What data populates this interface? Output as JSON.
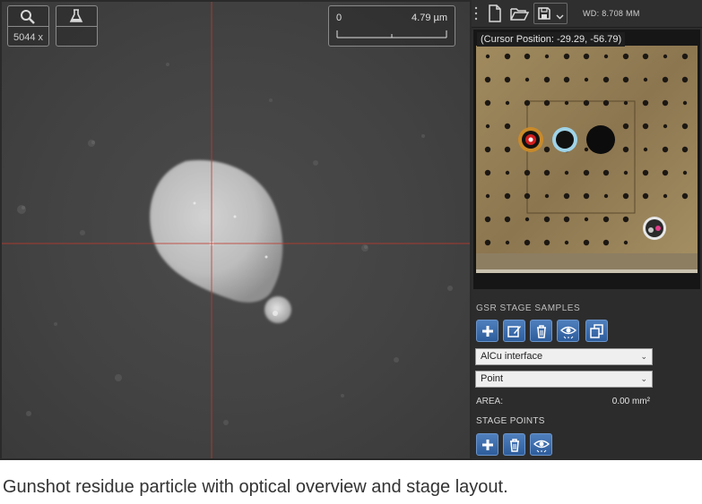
{
  "sem_view": {
    "magnification": "5044 x",
    "scale_bar": {
      "start_label": "0",
      "length_label": "4.79 µm"
    },
    "icons": [
      "magnifier-icon",
      "flask-icon"
    ]
  },
  "toolbar": {
    "icons": [
      "grip-icon",
      "new-document-icon",
      "open-folder-icon",
      "save-icon",
      "chevron-down-icon"
    ],
    "working_distance": "WD: 8.708 MM"
  },
  "overview": {
    "cursor_position": "(Cursor Position: -29.29, -56.79)"
  },
  "gsr_stage_samples": {
    "title": "GSR STAGE SAMPLES",
    "buttons": [
      "add-icon",
      "edit-icon",
      "delete-icon",
      "view-icon",
      "copy-icon"
    ],
    "sample_select": "AlCu interface",
    "mode_select": "Point",
    "area_label": "AREA:",
    "area_value": "0.00 mm²"
  },
  "stage_points": {
    "title": "STAGE POINTS",
    "buttons": [
      "add-icon",
      "delete-icon",
      "view-icon"
    ]
  },
  "caption": "Gunshot residue particle with optical overview and stage layout.",
  "colors": {
    "crosshair": "#c0392b",
    "button_blue": "#3a6bab",
    "stage_brass": "#9c8458"
  }
}
